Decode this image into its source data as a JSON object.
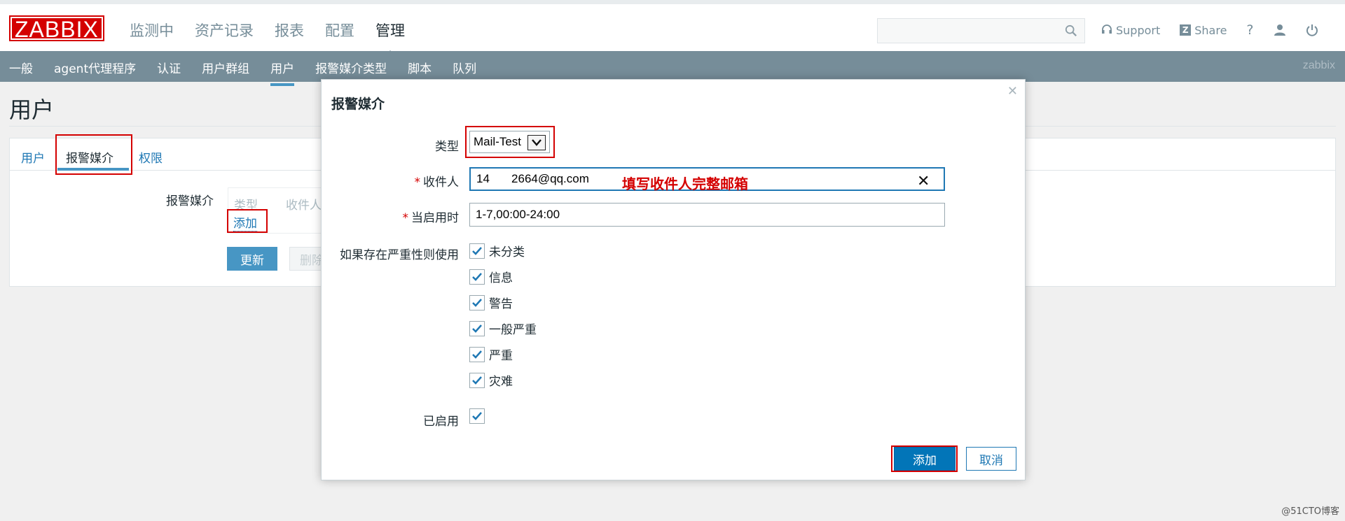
{
  "header": {
    "logo": "ZABBIX",
    "nav": [
      "监测中",
      "资产记录",
      "报表",
      "配置",
      "管理"
    ],
    "active_nav": 4,
    "search": {
      "value": "",
      "placeholder": ""
    },
    "support_label": "Support",
    "share_label": "Share",
    "help_label": "?"
  },
  "subnav": {
    "items": [
      "一般",
      "agent代理程序",
      "认证",
      "用户群组",
      "用户",
      "报警媒介类型",
      "脚本",
      "队列"
    ],
    "active": 4,
    "username": "zabbix"
  },
  "page": {
    "title": "用户",
    "tabs": [
      "用户",
      "报警媒介",
      "权限"
    ],
    "active_tab": 1,
    "media_label": "报警媒介",
    "media_columns": [
      "类型",
      "收件人"
    ],
    "add_link": "添加",
    "update_button": "更新",
    "delete_button": "删除"
  },
  "modal": {
    "title": "报警媒介",
    "type_label": "类型",
    "type_value": "Mail-Test",
    "recipient_label": "收件人",
    "recipient_value": "14           2664@qq.com",
    "recipient_annotation": "填写收件人完整邮箱",
    "when_active_label": "当启用时",
    "when_active_value": "1-7,00:00-24:00",
    "severity_label": "如果存在严重性则使用",
    "severities": [
      {
        "label": "未分类",
        "checked": true
      },
      {
        "label": "信息",
        "checked": true
      },
      {
        "label": "警告",
        "checked": true
      },
      {
        "label": "一般严重",
        "checked": true
      },
      {
        "label": "严重",
        "checked": true
      },
      {
        "label": "灾难",
        "checked": true
      }
    ],
    "enabled_label": "已启用",
    "enabled": true,
    "add_button": "添加",
    "cancel_button": "取消"
  },
  "watermark": "@51CTO博客",
  "colors": {
    "brand_red": "#d40000",
    "subnav_bg": "#768d99",
    "link_blue": "#1f78b4",
    "primary_button": "#0275b8"
  }
}
